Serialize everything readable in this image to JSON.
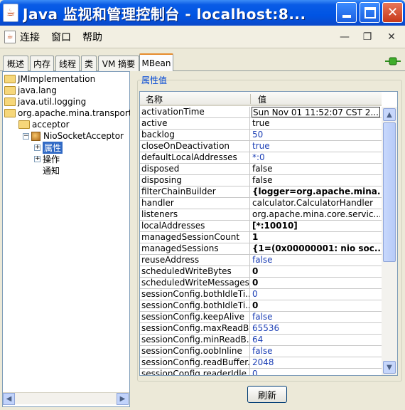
{
  "window": {
    "title": "Java 监视和管理控制台 - localhost:8..."
  },
  "menubar": {
    "items": [
      "连接",
      "窗口",
      "帮助"
    ]
  },
  "tabs": [
    {
      "label": "概述"
    },
    {
      "label": "内存"
    },
    {
      "label": "线程"
    },
    {
      "label": "类"
    },
    {
      "label": "VM 摘要"
    },
    {
      "label": "MBean",
      "active": true
    }
  ],
  "tree": {
    "items": [
      {
        "label": "JMImplementation"
      },
      {
        "label": "java.lang"
      },
      {
        "label": "java.util.logging"
      },
      {
        "label": "org.apache.mina.transport."
      },
      {
        "label": "acceptor"
      },
      {
        "label": "NioSocketAcceptor"
      },
      {
        "label": "属性"
      },
      {
        "label": "操作"
      },
      {
        "label": "通知"
      }
    ]
  },
  "attributes": {
    "group_title": "属性值",
    "columns": {
      "name": "名称",
      "value": "值"
    },
    "rows": [
      {
        "name": "activationTime",
        "value": "Sun Nov 01 11:52:07 CST 2..."
      },
      {
        "name": "active",
        "value": "true"
      },
      {
        "name": "backlog",
        "value": "50"
      },
      {
        "name": "closeOnDeactivation",
        "value": "true"
      },
      {
        "name": "defaultLocalAddresses",
        "value": "*:0"
      },
      {
        "name": "disposed",
        "value": "false"
      },
      {
        "name": "disposing",
        "value": "false"
      },
      {
        "name": "filterChainBuilder",
        "value": "{logger=org.apache.mina..."
      },
      {
        "name": "handler",
        "value": "calculator.CalculatorHandler"
      },
      {
        "name": "listeners",
        "value": "org.apache.mina.core.servic..."
      },
      {
        "name": "localAddresses",
        "value": "[*:10010]"
      },
      {
        "name": "managedSessionCount",
        "value": "1"
      },
      {
        "name": "managedSessions",
        "value": "{1=(0x00000001: nio soc..."
      },
      {
        "name": "reuseAddress",
        "value": "false"
      },
      {
        "name": "scheduledWriteBytes",
        "value": "0"
      },
      {
        "name": "scheduledWriteMessages",
        "value": "0"
      },
      {
        "name": "sessionConfig.bothIdleTi...",
        "value": "0"
      },
      {
        "name": "sessionConfig.bothIdleTi...",
        "value": "0"
      },
      {
        "name": "sessionConfig.keepAlive",
        "value": "false"
      },
      {
        "name": "sessionConfig.maxReadB...",
        "value": "65536"
      },
      {
        "name": "sessionConfig.minReadB...",
        "value": "64"
      },
      {
        "name": "sessionConfig.oobInline",
        "value": "false"
      },
      {
        "name": "sessionConfig.readBuffer...",
        "value": "2048"
      },
      {
        "name": "sessionConfig.readerIdle...",
        "value": "0"
      }
    ]
  },
  "buttons": {
    "refresh": "刷新"
  },
  "colors": {
    "titlebar": "#0054e3",
    "selection": "#316ac5",
    "value_blue": "#1c3fb5",
    "group_title": "#0046d5"
  }
}
